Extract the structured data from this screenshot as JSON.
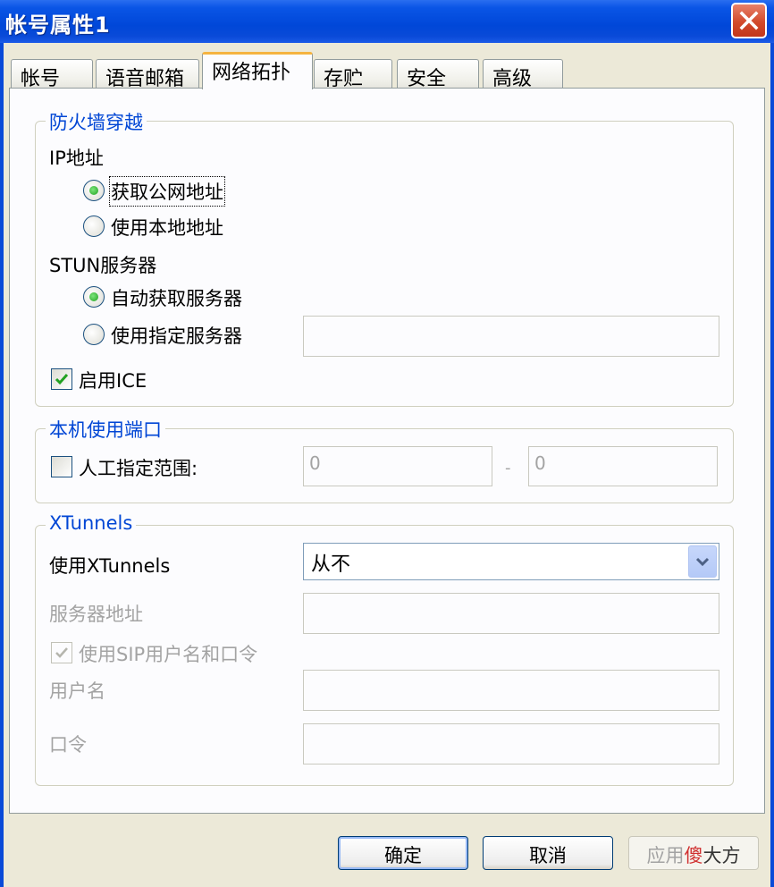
{
  "window": {
    "title": "帐号属性1",
    "close_icon": "close-icon"
  },
  "tabs": [
    {
      "label": "帐号",
      "active": false
    },
    {
      "label": "语音邮箱",
      "active": false
    },
    {
      "label": "网络拓扑",
      "active": true
    },
    {
      "label": "存贮",
      "active": false
    },
    {
      "label": "安全",
      "active": false
    },
    {
      "label": "高级",
      "active": false
    }
  ],
  "firewall": {
    "legend": "防火墙穿越",
    "ip_label": "IP地址",
    "ip_options": [
      {
        "label": "获取公网地址",
        "checked": true
      },
      {
        "label": "使用本地地址",
        "checked": false
      }
    ],
    "stun_label": "STUN服务器",
    "stun_options": [
      {
        "label": "自动获取服务器",
        "checked": true
      },
      {
        "label": "使用指定服务器",
        "checked": false
      }
    ],
    "stun_server_value": "",
    "ice_label": "启用ICE",
    "ice_checked": true
  },
  "ports": {
    "legend": "本机使用端口",
    "manual_label": "人工指定范围:",
    "manual_checked": false,
    "from_value": "0",
    "separator": "-",
    "to_value": "0"
  },
  "xtunnels": {
    "legend": "XTunnels",
    "use_label": "使用XTunnels",
    "use_value": "从不",
    "server_label": "服务器地址",
    "server_value": "",
    "sip_label": "使用SIP用户名和口令",
    "sip_checked": true,
    "username_label": "用户名",
    "username_value": "",
    "password_label": "口令",
    "password_value": ""
  },
  "buttons": {
    "ok": "确定",
    "cancel": "取消",
    "apply_prefix": "应用",
    "apply_watermark": "傻",
    "apply_suffix": "大方"
  },
  "colors": {
    "titlebar": "#0047d8",
    "legend": "#0046d5",
    "tab_highlight": "#f5b440"
  }
}
